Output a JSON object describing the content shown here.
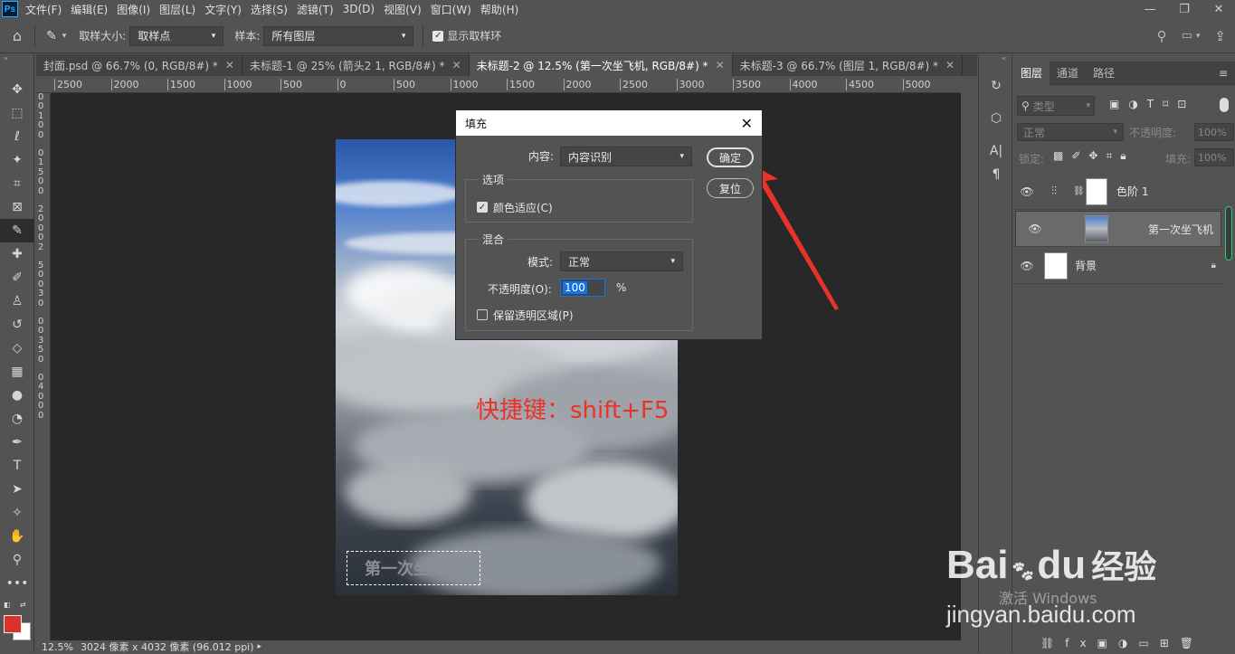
{
  "menubar": {
    "logo": "Ps",
    "items": [
      "文件(F)",
      "编辑(E)",
      "图像(I)",
      "图层(L)",
      "文字(Y)",
      "选择(S)",
      "滤镜(T)",
      "3D(D)",
      "视图(V)",
      "窗口(W)",
      "帮助(H)"
    ]
  },
  "options": {
    "sample_size_label": "取样大小:",
    "sample_size_value": "取样点",
    "sample_label": "样本:",
    "sample_value": "所有图层",
    "show_ring_label": "显示取样环"
  },
  "tabs": [
    {
      "label": "封面.psd @ 66.7% (0, RGB/8#) *"
    },
    {
      "label": "未标题-1 @ 25% (箭头2 1, RGB/8#) *"
    },
    {
      "label": "未标题-2 @ 12.5% (第一次坐飞机, RGB/8#) *"
    },
    {
      "label": "未标题-3 @ 66.7% (图层 1, RGB/8#) *"
    }
  ],
  "ruler_h": [
    "2500",
    "2000",
    "1500",
    "1000",
    "500",
    "0",
    "500",
    "1000",
    "1500",
    "2000",
    "2500",
    "3000",
    "3500",
    "4000",
    "4500",
    "5000"
  ],
  "ruler_v": [
    "0",
    "0",
    "1",
    "0",
    "0",
    "0",
    "1",
    "5",
    "0",
    "0",
    "2",
    "0",
    "0",
    "0",
    "2",
    "5",
    "0",
    "0",
    "3",
    "0",
    "0",
    "0",
    "3",
    "5",
    "0",
    "0",
    "4",
    "0",
    "0",
    "0"
  ],
  "canvas": {
    "annotation": "快捷键：shift+F5",
    "selection_text": "第一次坐飞机"
  },
  "dialog": {
    "title": "填充",
    "content_label": "内容:",
    "content_value": "内容识别",
    "ok": "确定",
    "reset": "复位",
    "options_title": "选项",
    "color_adapt": "颜色适应(C)",
    "blend_title": "混合",
    "mode_label": "模式:",
    "mode_value": "正常",
    "opacity_label": "不透明度(O):",
    "opacity_value": "100",
    "opacity_unit": "%",
    "preserve": "保留透明区域(P)"
  },
  "layers_panel": {
    "tabs": [
      "图层",
      "通道",
      "路径"
    ],
    "filter_placeholder": "类型",
    "blend_mode": "正常",
    "opacity_label": "不透明度:",
    "opacity_value": "100%",
    "lock_label": "锁定:",
    "fill_label": "填充:",
    "fill_value": "100%",
    "layers": [
      {
        "name": "色阶 1"
      },
      {
        "name": "第一次坐飞机"
      },
      {
        "name": "背景"
      }
    ]
  },
  "status": {
    "zoom": "12.5%",
    "info": "3024 像素 x 4032 像素 (96.012 ppi)"
  },
  "watermark": {
    "brand": "Bai",
    "brand2": "du",
    "brand_cn": "经验",
    "url": "jingyan.baidu.com",
    "activate": "激活 Windows"
  },
  "colors": {
    "accent_red": "#e8332a",
    "foreground": "#d9332b",
    "background": "#ffffff"
  }
}
